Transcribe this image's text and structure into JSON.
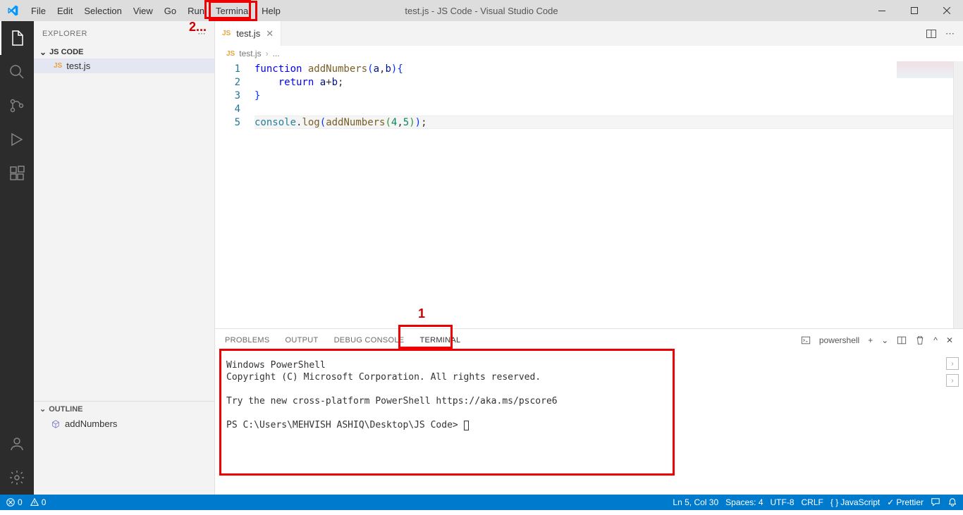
{
  "titlebar": {
    "menu": [
      "File",
      "Edit",
      "Selection",
      "View",
      "Go",
      "Run",
      "Terminal",
      "Help"
    ],
    "highlighted_index": 6,
    "title": "test.js - JS Code - Visual Studio Code"
  },
  "annotations": {
    "a1": "1",
    "a2": "2"
  },
  "activity_bar": {
    "top_icons": [
      "files-icon",
      "search-icon",
      "source-control-icon",
      "run-debug-icon",
      "extensions-icon"
    ],
    "bottom_icons": [
      "accounts-icon",
      "settings-icon"
    ]
  },
  "sidebar": {
    "title": "EXPLORER",
    "project": "JS CODE",
    "file": {
      "icon": "JS",
      "name": "test.js"
    },
    "outline": {
      "title": "OUTLINE",
      "item": "addNumbers"
    }
  },
  "tabs": {
    "active": {
      "icon": "JS",
      "name": "test.js"
    }
  },
  "breadcrumb": {
    "file_icon": "JS",
    "file": "test.js",
    "symbol": "..."
  },
  "code": {
    "line_numbers": [
      "1",
      "2",
      "3",
      "4",
      "5"
    ],
    "lines": [
      {
        "tokens": [
          [
            "kw",
            "function "
          ],
          [
            "fn",
            "addNumbers"
          ],
          [
            "br",
            "("
          ],
          [
            "vr",
            "a"
          ],
          [
            "",
            ","
          ],
          [
            "vr",
            "b"
          ],
          [
            "br",
            ")"
          ],
          [
            "br",
            "{"
          ]
        ]
      },
      {
        "tokens": [
          [
            "",
            "    "
          ],
          [
            "kw",
            "return "
          ],
          [
            "vr",
            "a"
          ],
          [
            "",
            "+"
          ],
          [
            "vr",
            "b"
          ],
          [
            "",
            ";"
          ]
        ]
      },
      {
        "tokens": [
          [
            "br",
            "}"
          ]
        ]
      },
      {
        "tokens": [
          [
            "",
            ""
          ]
        ]
      },
      {
        "tokens": [
          [
            "obj",
            "console"
          ],
          [
            "",
            "."
          ],
          [
            "fn",
            "log"
          ],
          [
            "br",
            "("
          ],
          [
            "fn",
            "addNumbers"
          ],
          [
            "br2",
            "("
          ],
          [
            "num",
            "4"
          ],
          [
            "",
            ","
          ],
          [
            "num",
            "5"
          ],
          [
            "br2",
            ")"
          ],
          [
            "br",
            ")"
          ],
          [
            "",
            ";"
          ]
        ],
        "current": true
      }
    ]
  },
  "panel": {
    "tabs": [
      "PROBLEMS",
      "OUTPUT",
      "DEBUG CONSOLE",
      "TERMINAL"
    ],
    "active_index": 3,
    "shell_label": "powershell",
    "terminal_text": "Windows PowerShell\nCopyright (C) Microsoft Corporation. All rights reserved.\n\nTry the new cross-platform PowerShell https://aka.ms/pscore6\n\nPS C:\\Users\\MEHVISH ASHIQ\\Desktop\\JS Code> "
  },
  "statusbar": {
    "errors": "0",
    "warnings": "0",
    "ln_col": "Ln 5, Col 30",
    "spaces": "Spaces: 4",
    "encoding": "UTF-8",
    "eol": "CRLF",
    "language": "JavaScript",
    "prettier": "Prettier"
  }
}
